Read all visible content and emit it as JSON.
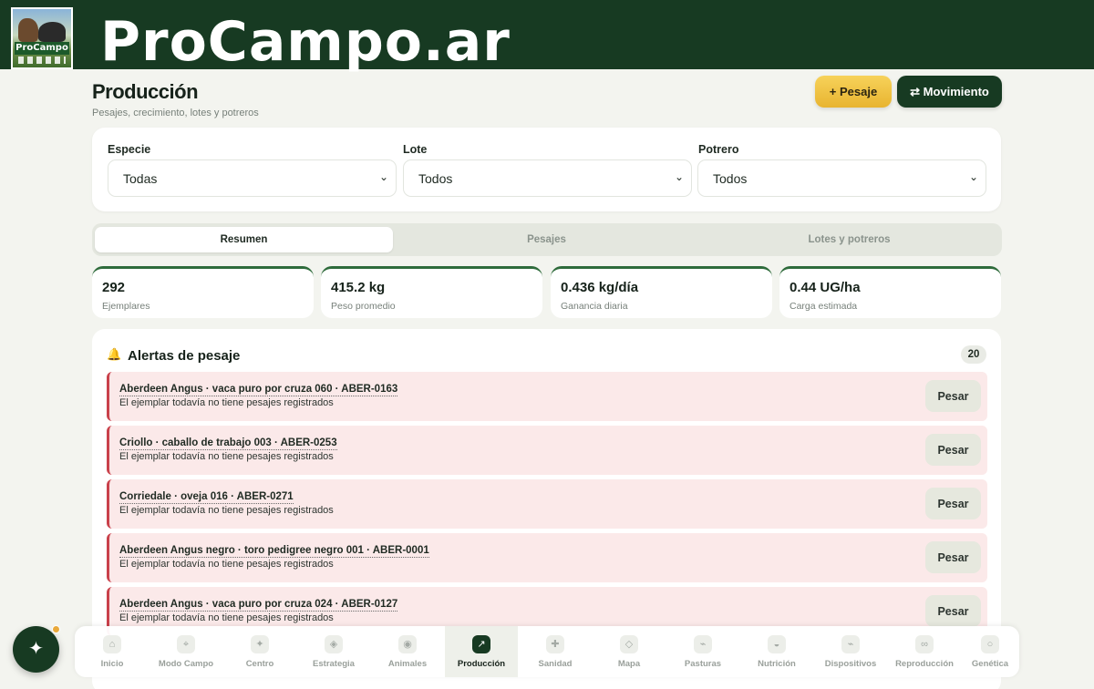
{
  "brand": {
    "name": "ProCampo.ar",
    "logo_text": "ProCampo"
  },
  "header": {
    "title": "Producción",
    "subtitle": "Pesajes, crecimiento, lotes y potreros",
    "pesaje_label": "+ Pesaje",
    "movimiento_label": "⇄ Movimiento"
  },
  "filters": [
    {
      "label": "Especie",
      "value": "Todas"
    },
    {
      "label": "Lote",
      "value": "Todos"
    },
    {
      "label": "Potrero",
      "value": "Todos"
    }
  ],
  "tabs": [
    {
      "label": "Resumen",
      "active": true
    },
    {
      "label": "Pesajes",
      "active": false
    },
    {
      "label": "Lotes y potreros",
      "active": false
    }
  ],
  "stats": [
    {
      "value": "292",
      "label": "Ejemplares"
    },
    {
      "value": "415.2 kg",
      "label": "Peso promedio"
    },
    {
      "value": "0.436 kg/día",
      "label": "Ganancia diaria"
    },
    {
      "value": "0.44 UG/ha",
      "label": "Carga estimada"
    }
  ],
  "alerts": {
    "title": "Alertas de pesaje",
    "count": "20",
    "action_label": "Pesar",
    "items": [
      {
        "title": "Aberdeen Angus · vaca puro por cruza 060 · ABER-0163",
        "subtitle": "El ejemplar todavía no tiene pesajes registrados"
      },
      {
        "title": "Criollo · caballo de trabajo 003 · ABER-0253",
        "subtitle": "El ejemplar todavía no tiene pesajes registrados"
      },
      {
        "title": "Corriedale · oveja 016 · ABER-0271",
        "subtitle": "El ejemplar todavía no tiene pesajes registrados"
      },
      {
        "title": "Aberdeen Angus negro · toro pedigree negro 001 · ABER-0001",
        "subtitle": "El ejemplar todavía no tiene pesajes registrados"
      },
      {
        "title": "Aberdeen Angus · vaca puro por cruza 024 · ABER-0127",
        "subtitle": "El ejemplar todavía no tiene pesajes registrados"
      }
    ]
  },
  "nav": [
    {
      "label": "Inicio",
      "icon": "⌂"
    },
    {
      "label": "Modo Campo",
      "icon": "⌖"
    },
    {
      "label": "Centro",
      "icon": "✦"
    },
    {
      "label": "Estrategia",
      "icon": "◈"
    },
    {
      "label": "Animales",
      "icon": "◉"
    },
    {
      "label": "Producción",
      "icon": "↗",
      "active": true
    },
    {
      "label": "Sanidad",
      "icon": "✚"
    },
    {
      "label": "Mapa",
      "icon": "◇"
    },
    {
      "label": "Pasturas",
      "icon": "⌁"
    },
    {
      "label": "Nutrición",
      "icon": "◒"
    },
    {
      "label": "Dispositivos",
      "icon": "⌁"
    },
    {
      "label": "Reproducción",
      "icon": "∞"
    },
    {
      "label": "Genética",
      "icon": "○"
    }
  ],
  "assistant_icon": "✦",
  "colors": {
    "brand_dark": "#173a22",
    "accent_yellow": "#f0c544",
    "alert_red": "#c9414b",
    "alert_bg": "#fbe9e9"
  }
}
